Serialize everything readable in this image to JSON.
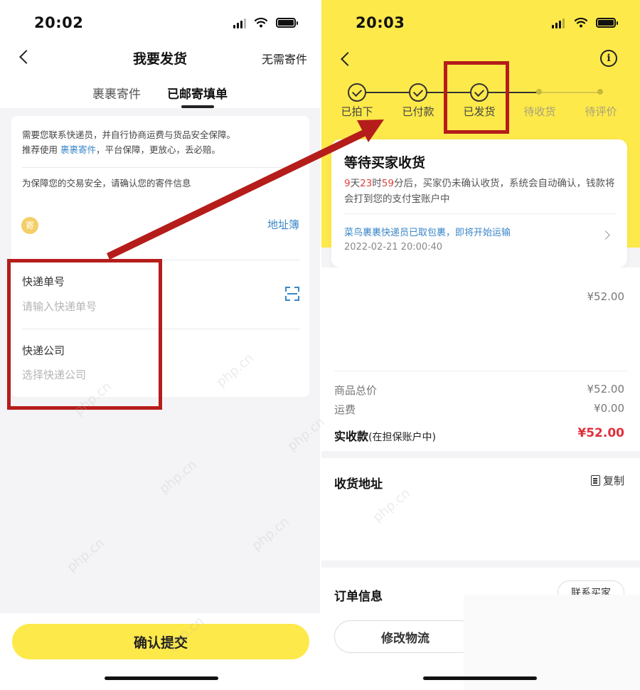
{
  "left": {
    "status_time": "20:02",
    "title": "我要发货",
    "right_action": "无需寄件",
    "tabs": [
      "裹裹寄件",
      "已邮寄填单"
    ],
    "notice_line1": "需要您联系快递员，并自行协商运费与货品安全保障。",
    "notice_line2_prefix": "推荐使用",
    "notice_line2_link": "裹裹寄件",
    "notice_line2_suffix": "，平台保障，更放心，丢必赔。",
    "confirm_tip": "为保障您的交易安全，请确认您的寄件信息",
    "sender_badge": "寄",
    "address_book": "地址簿",
    "tracking_label": "快递单号",
    "tracking_placeholder": "请输入快递单号",
    "company_label": "快递公司",
    "company_placeholder": "选择快递公司",
    "submit": "确认提交"
  },
  "right": {
    "status_time": "20:03",
    "info_icon": "i",
    "steps": [
      {
        "label": "已拍下",
        "done": true
      },
      {
        "label": "已付款",
        "done": true
      },
      {
        "label": "已发货",
        "done": true
      },
      {
        "label": "待收货",
        "done": false
      },
      {
        "label": "待评价",
        "done": false
      }
    ],
    "status_title": "等待买家收货",
    "countdown_days": "9",
    "countdown_days_unit": "天",
    "countdown_hours": "23",
    "countdown_hours_unit": "时",
    "countdown_minutes": "59",
    "countdown_rest": "分后，买家仍未确认收货，系统会自动确认，钱款将会打到您的支付宝账户中",
    "logistics_text": "菜鸟裹裹快递员已取包裹，即将开始运输",
    "logistics_time": "2022-02-21 20:00:40",
    "item_price": "¥52.00",
    "goods_total_label": "商品总价",
    "goods_total_value": "¥52.00",
    "shipping_label": "运费",
    "shipping_value": "¥0.00",
    "received_label": "实收款",
    "received_note": "(在担保账户中)",
    "received_value": "¥52.00",
    "address_title": "收货地址",
    "copy_label": "复制",
    "order_title": "订单信息",
    "contact_buyer": "联系买家",
    "modify_logistics": "修改物流"
  },
  "colors": {
    "brand_yellow": "#fde94a",
    "link_blue": "#3a86c8",
    "price_red": "#e0303a",
    "annotation_red": "#b51d1a"
  },
  "watermark": "php.cn"
}
